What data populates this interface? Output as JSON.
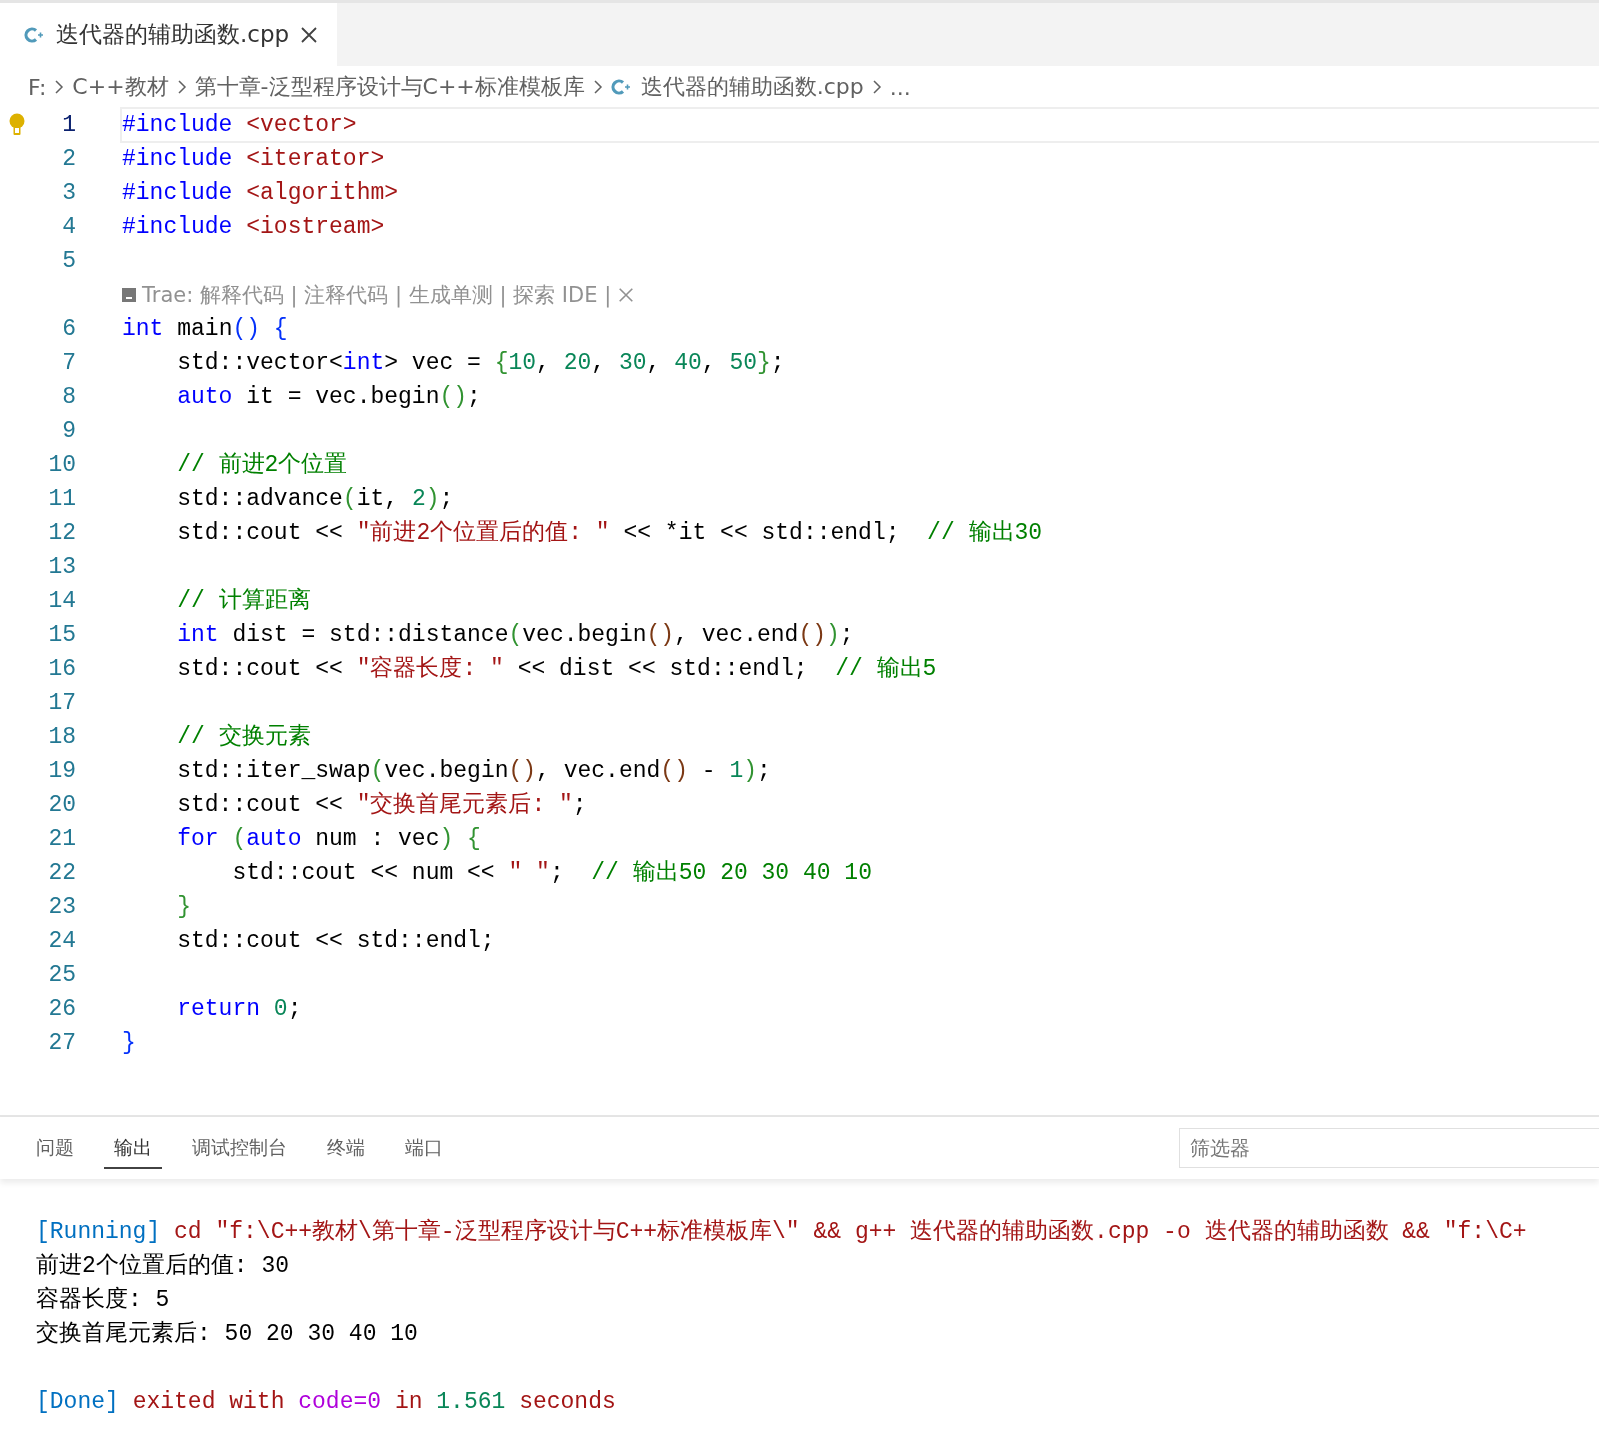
{
  "tabs": [
    {
      "label": "迭代器的辅助函数.cpp",
      "selected": true
    }
  ],
  "breadcrumbs": [
    {
      "kind": "folder",
      "label": "F:"
    },
    {
      "kind": "folder",
      "label": "C++教材"
    },
    {
      "kind": "folder",
      "label": "第十章-泛型程序设计与C++标准模板库"
    },
    {
      "kind": "file",
      "label": "迭代器的辅助函数.cpp"
    },
    {
      "kind": "more",
      "label": "..."
    }
  ],
  "editor": {
    "lines": [
      {
        "kind": "code",
        "number": "1",
        "active": true,
        "tokens": [
          {
            "t": "#include ",
            "kind": "kw"
          },
          {
            "t": "<vector>",
            "kind": "str"
          }
        ]
      },
      {
        "kind": "code",
        "number": "2",
        "active": false,
        "tokens": [
          {
            "t": "#include ",
            "kind": "kw"
          },
          {
            "t": "<iterator>",
            "kind": "str"
          }
        ]
      },
      {
        "kind": "code",
        "number": "3",
        "active": false,
        "tokens": [
          {
            "t": "#include ",
            "kind": "kw"
          },
          {
            "t": "<algorithm>",
            "kind": "str"
          }
        ]
      },
      {
        "kind": "code",
        "number": "4",
        "active": false,
        "tokens": [
          {
            "t": "#include ",
            "kind": "kw"
          },
          {
            "t": "<iostream>",
            "kind": "str"
          }
        ]
      },
      {
        "kind": "code",
        "number": "5",
        "active": false
      },
      {
        "kind": "codelens",
        "text": "Trae: 解释代码 | 注释代码 | 生成单测 | 探索 IDE |"
      },
      {
        "kind": "code",
        "number": "6",
        "active": false,
        "tokens": [
          {
            "t": "int",
            "kind": "kw"
          },
          {
            "t": " main",
            "kind": "plain"
          },
          {
            "t": "() {",
            "kind": "b1"
          }
        ]
      },
      {
        "kind": "code",
        "number": "7",
        "active": false,
        "tokens": [
          {
            "t": "    std::vector<",
            "kind": "plain"
          },
          {
            "t": "int",
            "kind": "kw"
          },
          {
            "t": "> vec = ",
            "kind": "plain"
          },
          {
            "t": "{",
            "kind": "b2"
          },
          {
            "t": "10",
            "kind": "num"
          },
          {
            "t": ", ",
            "kind": "plain"
          },
          {
            "t": "20",
            "kind": "num"
          },
          {
            "t": ", ",
            "kind": "plain"
          },
          {
            "t": "30",
            "kind": "num"
          },
          {
            "t": ", ",
            "kind": "plain"
          },
          {
            "t": "40",
            "kind": "num"
          },
          {
            "t": ", ",
            "kind": "plain"
          },
          {
            "t": "50",
            "kind": "num"
          },
          {
            "t": "}",
            "kind": "b2"
          },
          {
            "t": ";",
            "kind": "plain"
          }
        ]
      },
      {
        "kind": "code",
        "number": "8",
        "active": false,
        "tokens": [
          {
            "t": "    auto",
            "kind": "kw"
          },
          {
            "t": " it = vec.begin",
            "kind": "plain"
          },
          {
            "t": "()",
            "kind": "b2"
          },
          {
            "t": ";",
            "kind": "plain"
          }
        ]
      },
      {
        "kind": "code",
        "number": "9",
        "active": false
      },
      {
        "kind": "code",
        "number": "10",
        "active": false,
        "tokens": [
          {
            "t": "    // 前进2个位置",
            "kind": "cmt"
          }
        ]
      },
      {
        "kind": "code",
        "number": "11",
        "active": false,
        "tokens": [
          {
            "t": "    std::advance",
            "kind": "plain"
          },
          {
            "t": "(",
            "kind": "b2"
          },
          {
            "t": "it, ",
            "kind": "plain"
          },
          {
            "t": "2",
            "kind": "num"
          },
          {
            "t": ")",
            "kind": "b2"
          },
          {
            "t": ";",
            "kind": "plain"
          }
        ]
      },
      {
        "kind": "code",
        "number": "12",
        "active": false,
        "tokens": [
          {
            "t": "    std::cout << ",
            "kind": "plain"
          },
          {
            "t": "\"前进2个位置后的值: \"",
            "kind": "str"
          },
          {
            "t": " << *it << std::endl;  ",
            "kind": "plain"
          },
          {
            "t": "// 输出30",
            "kind": "cmt"
          }
        ]
      },
      {
        "kind": "code",
        "number": "13",
        "active": false
      },
      {
        "kind": "code",
        "number": "14",
        "active": false,
        "tokens": [
          {
            "t": "    // 计算距离",
            "kind": "cmt"
          }
        ]
      },
      {
        "kind": "code",
        "number": "15",
        "active": false,
        "tokens": [
          {
            "t": "    int",
            "kind": "kw"
          },
          {
            "t": " dist = std::distance",
            "kind": "plain"
          },
          {
            "t": "(",
            "kind": "b2"
          },
          {
            "t": "vec.begin",
            "kind": "plain"
          },
          {
            "t": "()",
            "kind": "b3"
          },
          {
            "t": ", vec.end",
            "kind": "plain"
          },
          {
            "t": "()",
            "kind": "b3"
          },
          {
            "t": ")",
            "kind": "b2"
          },
          {
            "t": ";",
            "kind": "plain"
          }
        ]
      },
      {
        "kind": "code",
        "number": "16",
        "active": false,
        "tokens": [
          {
            "t": "    std::cout << ",
            "kind": "plain"
          },
          {
            "t": "\"容器长度: \"",
            "kind": "str"
          },
          {
            "t": " << dist << std::endl;  ",
            "kind": "plain"
          },
          {
            "t": "// 输出5",
            "kind": "cmt"
          }
        ]
      },
      {
        "kind": "code",
        "number": "17",
        "active": false
      },
      {
        "kind": "code",
        "number": "18",
        "active": false,
        "tokens": [
          {
            "t": "    // 交换元素",
            "kind": "cmt"
          }
        ]
      },
      {
        "kind": "code",
        "number": "19",
        "active": false,
        "tokens": [
          {
            "t": "    std::iter_swap",
            "kind": "plain"
          },
          {
            "t": "(",
            "kind": "b2"
          },
          {
            "t": "vec.begin",
            "kind": "plain"
          },
          {
            "t": "()",
            "kind": "b3"
          },
          {
            "t": ", vec.end",
            "kind": "plain"
          },
          {
            "t": "()",
            "kind": "b3"
          },
          {
            "t": " - ",
            "kind": "plain"
          },
          {
            "t": "1",
            "kind": "num"
          },
          {
            "t": ")",
            "kind": "b2"
          },
          {
            "t": ";",
            "kind": "plain"
          }
        ]
      },
      {
        "kind": "code",
        "number": "20",
        "active": false,
        "tokens": [
          {
            "t": "    std::cout << ",
            "kind": "plain"
          },
          {
            "t": "\"交换首尾元素后: \"",
            "kind": "str"
          },
          {
            "t": ";",
            "kind": "plain"
          }
        ]
      },
      {
        "kind": "code",
        "number": "21",
        "active": false,
        "tokens": [
          {
            "t": "    for ",
            "kind": "kw"
          },
          {
            "t": "(",
            "kind": "b2"
          },
          {
            "t": "auto",
            "kind": "kw"
          },
          {
            "t": " num : vec",
            "kind": "plain"
          },
          {
            "t": ") {",
            "kind": "b2"
          }
        ]
      },
      {
        "kind": "code",
        "number": "22",
        "active": false,
        "tokens": [
          {
            "t": "        std::cout << num << ",
            "kind": "plain"
          },
          {
            "t": "\" \"",
            "kind": "str"
          },
          {
            "t": ";  ",
            "kind": "plain"
          },
          {
            "t": "// 输出50 20 30 40 10",
            "kind": "cmt"
          }
        ]
      },
      {
        "kind": "code",
        "number": "23",
        "active": false,
        "tokens": [
          {
            "t": "    }",
            "kind": "b2"
          }
        ]
      },
      {
        "kind": "code",
        "number": "24",
        "active": false,
        "tokens": [
          {
            "t": "    std::cout << std::endl;",
            "kind": "plain"
          }
        ]
      },
      {
        "kind": "code",
        "number": "25",
        "active": false
      },
      {
        "kind": "code",
        "number": "26",
        "active": false,
        "tokens": [
          {
            "t": "    return ",
            "kind": "kw"
          },
          {
            "t": "0",
            "kind": "num"
          },
          {
            "t": ";",
            "kind": "plain"
          }
        ]
      },
      {
        "kind": "code",
        "number": "27",
        "active": false,
        "tokens": [
          {
            "t": "}",
            "kind": "b1"
          }
        ]
      }
    ]
  },
  "panel": {
    "tabs": [
      {
        "label": "问题",
        "selected": false
      },
      {
        "label": "输出",
        "selected": true
      },
      {
        "label": "调试控制台",
        "selected": false
      },
      {
        "label": "终端",
        "selected": false
      },
      {
        "label": "端口",
        "selected": false
      }
    ],
    "filter": {
      "placeholder": "筛选器"
    },
    "output": [
      {
        "kind": "text",
        "tokens": [
          {
            "t": "[Running]",
            "kind": "tag"
          },
          {
            "t": " cd \"f:\\C++教材\\第十章-泛型程序设计与C++标准模板库\\\" && g++ 迭代器的辅助函数.cpp -o 迭代器的辅助函数 && \"f:\\C+",
            "kind": "str"
          }
        ]
      },
      {
        "kind": "text",
        "tokens": [
          {
            "t": "前进2个位置后的值: 30",
            "kind": "plain"
          }
        ]
      },
      {
        "kind": "text",
        "tokens": [
          {
            "t": "容器长度: 5",
            "kind": "plain"
          }
        ]
      },
      {
        "kind": "text",
        "tokens": [
          {
            "t": "交换首尾元素后: 50 20 30 40 10",
            "kind": "plain"
          }
        ]
      },
      {
        "kind": "blank"
      },
      {
        "kind": "text",
        "tokens": [
          {
            "t": "[Done]",
            "kind": "tag"
          },
          {
            "t": " exited with ",
            "kind": "str"
          },
          {
            "t": "code=0",
            "kind": "var"
          },
          {
            "t": " in ",
            "kind": "str"
          },
          {
            "t": "1.561",
            "kind": "num"
          },
          {
            "t": " seconds",
            "kind": "str"
          }
        ]
      }
    ]
  }
}
